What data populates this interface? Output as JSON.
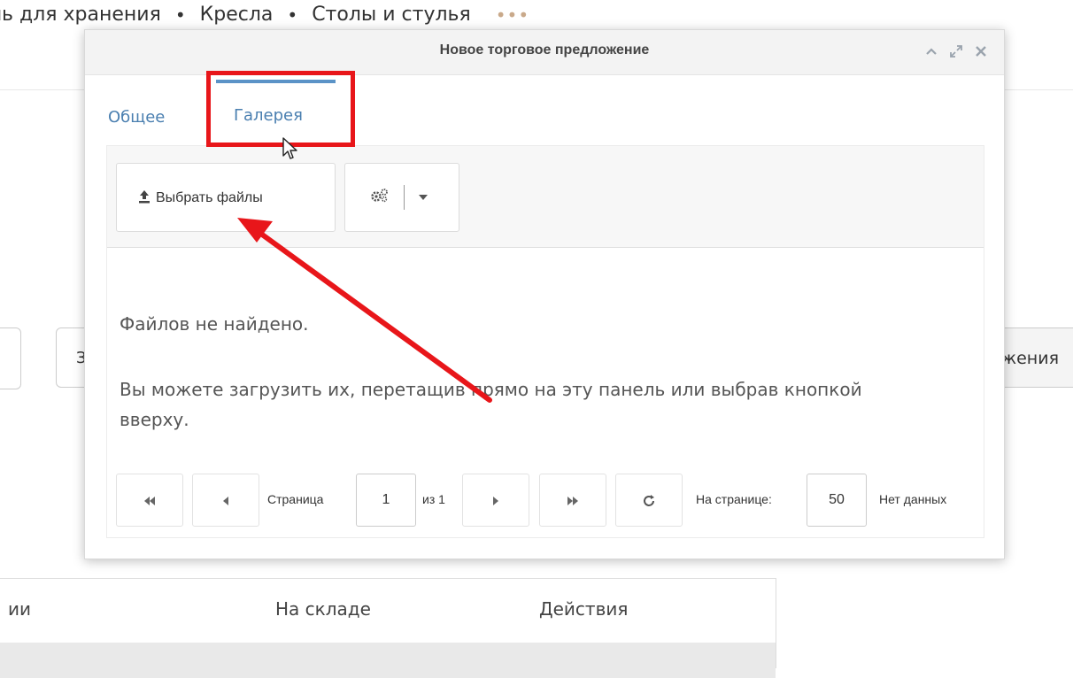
{
  "background": {
    "breadcrumbs": [
      "ль для хранения",
      "Кресла",
      "Столы и стулья"
    ],
    "separator": "•",
    "more": "•••",
    "input2_text": "З",
    "button_right": "жения",
    "table_headers": [
      "ии",
      "На складе",
      "Действия"
    ]
  },
  "modal": {
    "title": "Новое торговое предложение",
    "tabs": [
      "Общее",
      "Галерея"
    ],
    "active_tab": "Галерея",
    "toolbar": {
      "upload_label": "Выбрать файлы"
    },
    "empty": {
      "line1": "Файлов не найдено.",
      "line2": "Вы можете загрузить их, перетащив прямо на эту панель или выбрав кнопкой вверху."
    },
    "pager": {
      "page_label": "Страница",
      "page_value": "1",
      "of_label": "из 1",
      "per_page_label": "На странице:",
      "per_page_value": "50",
      "status": "Нет данных"
    }
  },
  "colors": {
    "highlight": "#e8161a",
    "arrow": "#e8161a",
    "tab_accent": "#5b93c7"
  }
}
